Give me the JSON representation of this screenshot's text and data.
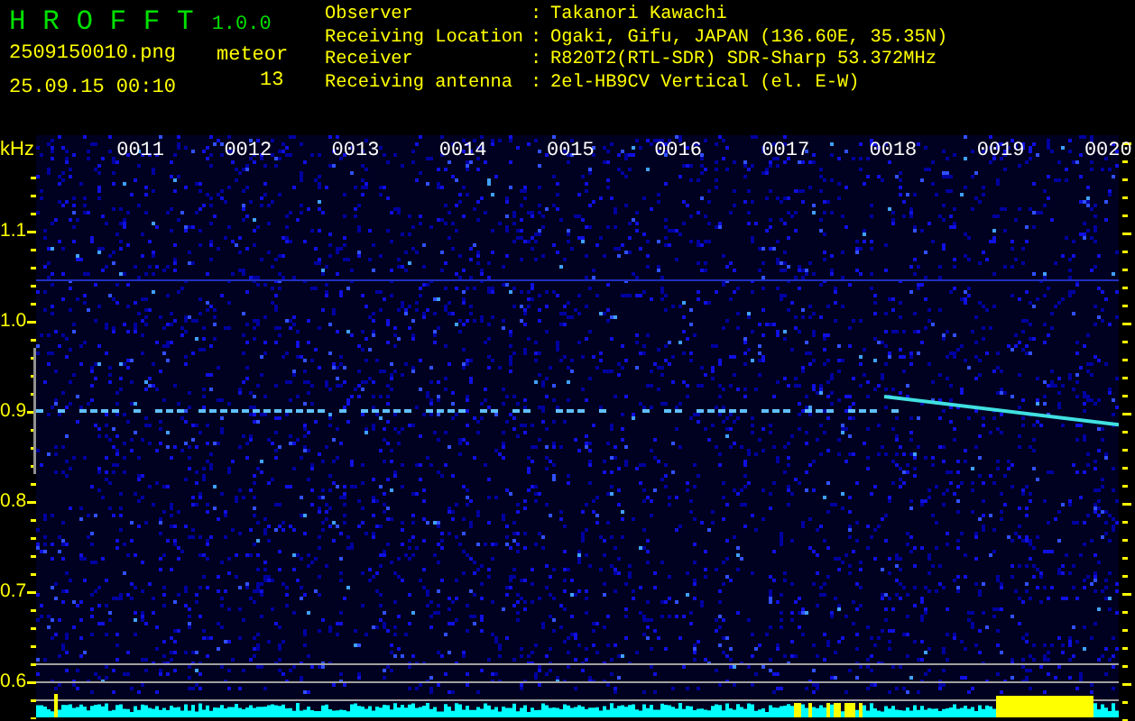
{
  "app": {
    "name": "H R O F F T",
    "version": "1.0.0",
    "file": "2509150010.png",
    "datetime": "25.09.15 00:10"
  },
  "meteor": {
    "label": "meteor",
    "count": "13"
  },
  "info": [
    {
      "label": "Observer",
      "separator": ":",
      "value": "Takanori Kawachi"
    },
    {
      "label": "Receiving Location",
      "separator": ":",
      "value": "Ogaki, Gifu, JAPAN (136.60E, 35.35N)"
    },
    {
      "label": "Receiver",
      "separator": ":",
      "value": "R820T2(RTL-SDR) SDR-Sharp 53.372MHz"
    },
    {
      "label": "Receiving antenna",
      "separator": ":",
      "value": "2el-HB9CV Vertical (el. E-W)"
    }
  ],
  "spectrogram": {
    "unit": "kHz",
    "frequency_labels": [
      "1.1",
      "1.0",
      "0.9",
      "0.8",
      "0.7",
      "0.6"
    ],
    "time_labels": [
      "0011",
      "0012",
      "0013",
      "0014",
      "0015",
      "0016",
      "0017",
      "0018",
      "0019",
      "0020"
    ]
  }
}
